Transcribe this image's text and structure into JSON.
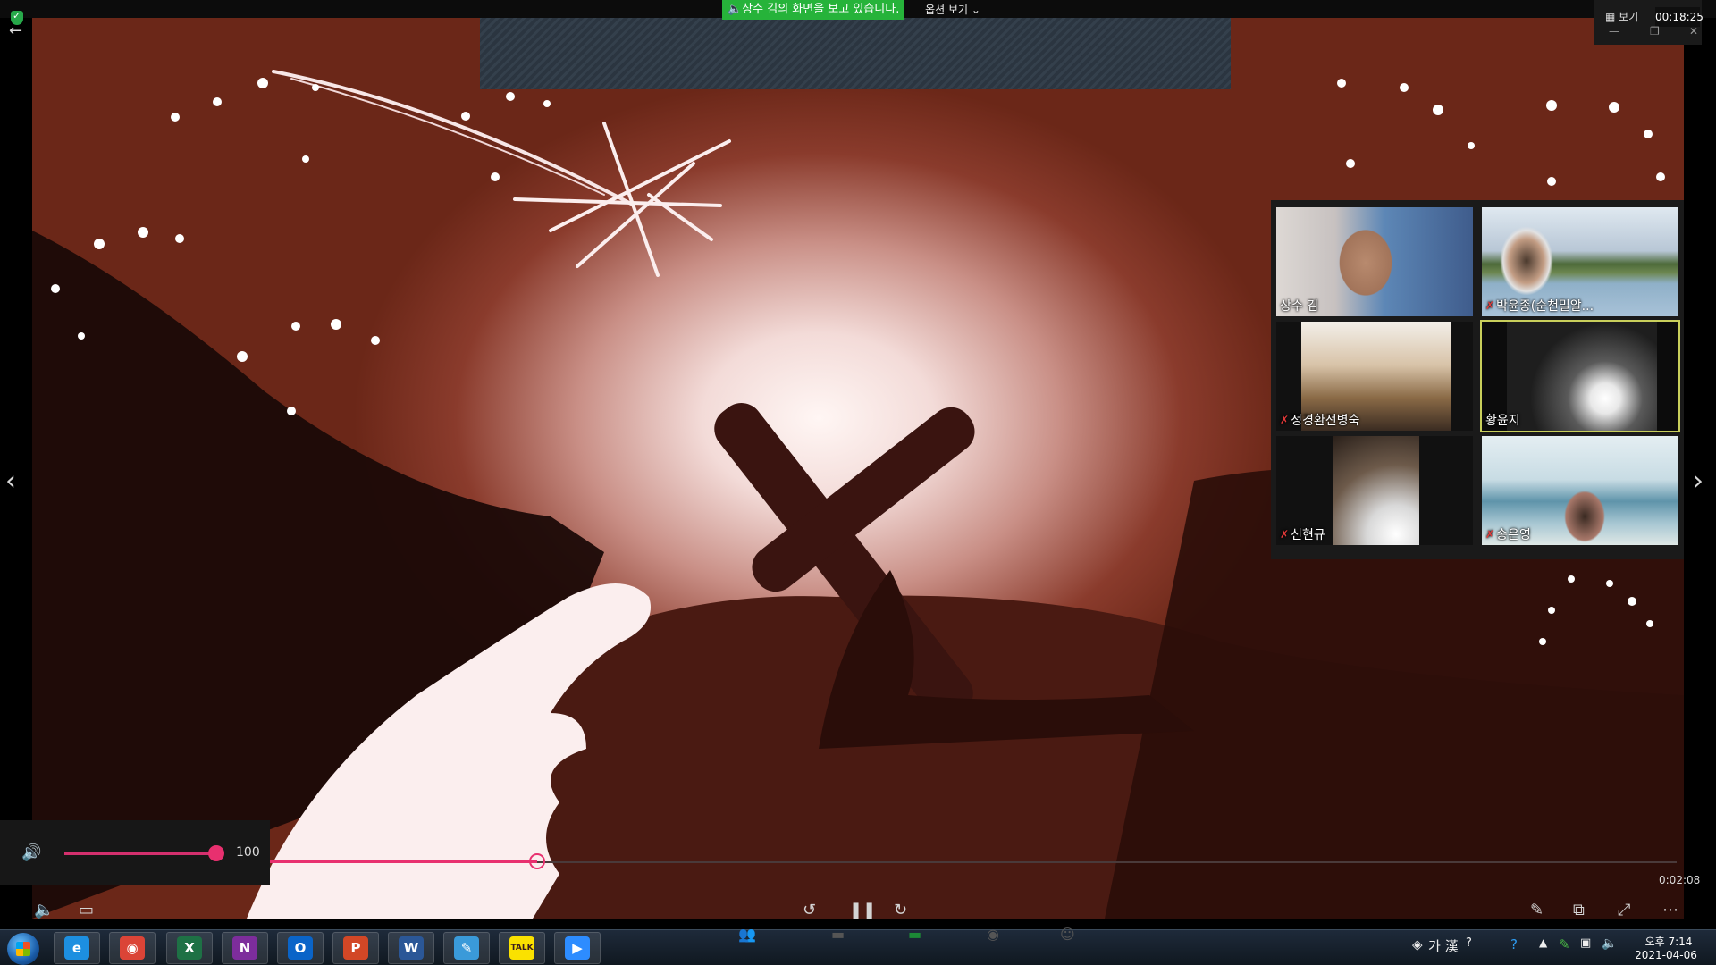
{
  "app": {
    "share_banner": "상수 김의 화면을 보고 있습니다.",
    "view_options": "옵션 보기",
    "view_button": "보기",
    "timer": "00:18:25"
  },
  "gallery": {
    "participants": [
      {
        "name": "상수 김",
        "muted": false,
        "active": false
      },
      {
        "name": "박윤종(순천밀알...",
        "muted": true,
        "active": false
      },
      {
        "name": "정경환전병숙",
        "muted": true,
        "active": false
      },
      {
        "name": "황윤지",
        "muted": false,
        "active": true
      },
      {
        "name": "신현규",
        "muted": true,
        "active": false
      },
      {
        "name": "송은영",
        "muted": true,
        "active": false
      }
    ]
  },
  "player": {
    "volume": "100",
    "volume_level": 1.0,
    "progress": 0.19,
    "duration": "0:02:08"
  },
  "icons": {
    "back": "back-arrow-icon",
    "speaker": "speaker-icon",
    "subtitles": "subtitles-icon",
    "rewind": "rewind-10-icon",
    "pause": "pause-icon",
    "forward": "forward-30-icon",
    "pen": "pen-icon",
    "pip": "picture-in-picture-icon",
    "expand": "expand-icon",
    "more": "more-icon"
  },
  "taskbar": {
    "ime": "가 漢",
    "clock_time": "오후 7:14",
    "clock_date": "2021-04-06",
    "apps": [
      {
        "name": "internet-explorer",
        "glyph": "e",
        "color": "#1d8fe0"
      },
      {
        "name": "chrome",
        "glyph": "◉",
        "color": "#db4437"
      },
      {
        "name": "excel",
        "glyph": "X",
        "color": "#1e7145"
      },
      {
        "name": "onenote",
        "glyph": "N",
        "color": "#7d2d9c"
      },
      {
        "name": "outlook",
        "glyph": "O",
        "color": "#0a64c8"
      },
      {
        "name": "powerpoint",
        "glyph": "P",
        "color": "#d24726"
      },
      {
        "name": "word",
        "glyph": "W",
        "color": "#2b5797"
      },
      {
        "name": "notepad-tool",
        "glyph": "✎",
        "color": "#3a9ad9"
      },
      {
        "name": "kakaotalk",
        "glyph": "TALK",
        "color": "#fae100"
      },
      {
        "name": "zoom",
        "glyph": "▶",
        "color": "#2d8cff"
      }
    ]
  },
  "colors": {
    "accent": "#e8306f",
    "share_green": "#26b33a",
    "active_border": "#c9cf5b"
  }
}
